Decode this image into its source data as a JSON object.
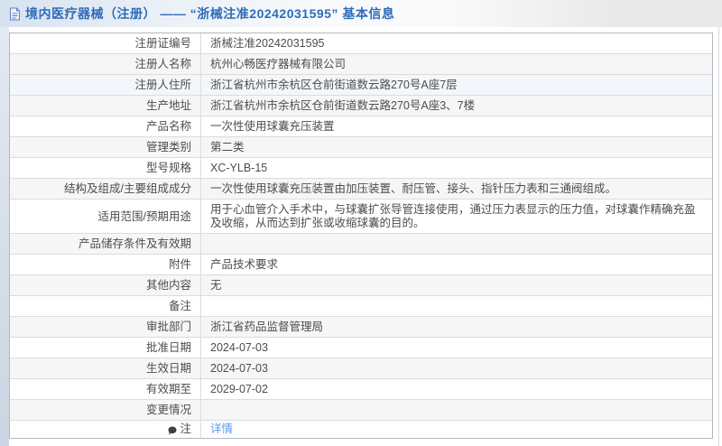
{
  "header": {
    "title": "境内医疗器械（注册） —— “浙械注准20242031595” 基本信息"
  },
  "table": {
    "rows": [
      {
        "label": "注册证编号",
        "value": "浙械注准20242031595"
      },
      {
        "label": "注册人名称",
        "value": "杭州心畅医疗器械有限公司"
      },
      {
        "label": "注册人住所",
        "value": "浙江省杭州市余杭区仓前街道数云路270号A座7层"
      },
      {
        "label": "生产地址",
        "value": "浙江省杭州市余杭区仓前街道数云路270号A座3、7楼"
      },
      {
        "label": "产品名称",
        "value": "一次性使用球囊充压装置"
      },
      {
        "label": "管理类别",
        "value": "第二类"
      },
      {
        "label": "型号规格",
        "value": "XC-YLB-15"
      },
      {
        "label": "结构及组成/主要组成成分",
        "value": "一次性使用球囊充压装置由加压装置、耐压管、接头、指针压力表和三通阀组成。"
      },
      {
        "label": "适用范围/预期用途",
        "value": "用于心血管介入手术中，与球囊扩张导管连接使用，通过压力表显示的压力值，对球囊作精确充盈及收缩，从而达到扩张或收缩球囊的目的。"
      },
      {
        "label": "产品储存条件及有效期",
        "value": ""
      },
      {
        "label": "附件",
        "value": "产品技术要求"
      },
      {
        "label": "其他内容",
        "value": "无"
      },
      {
        "label": "备注",
        "value": ""
      },
      {
        "label": "审批部门",
        "value": "浙江省药品监督管理局"
      },
      {
        "label": "批准日期",
        "value": "2024-07-03"
      },
      {
        "label": "生效日期",
        "value": "2024-07-03"
      },
      {
        "label": "有效期至",
        "value": "2029-07-02"
      },
      {
        "label": "变更情况",
        "value": ""
      },
      {
        "label": "注",
        "value": "详情"
      }
    ]
  },
  "colors": {
    "title_blue": "#2e6bb7",
    "link_blue": "#5b9bf0",
    "row_alt": "#f6f6f6",
    "row_highlight": "#f3f7fc",
    "table_border": "#b4b8bd"
  }
}
